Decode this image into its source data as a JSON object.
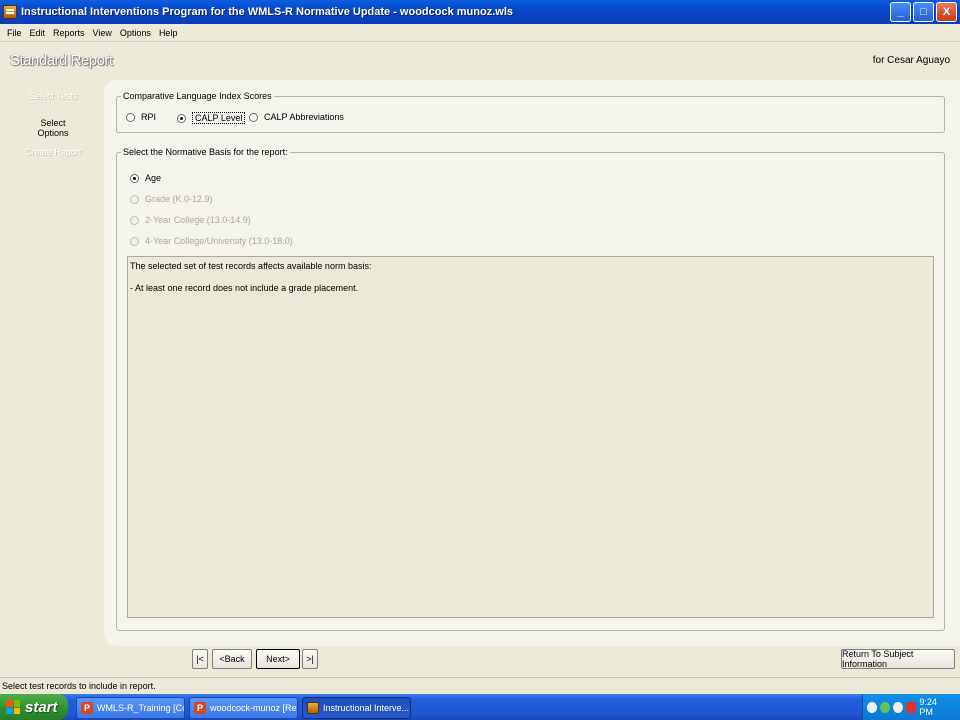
{
  "window": {
    "title": "Instructional Interventions Program for the WMLS-R Normative Update - woodcock munoz.wls",
    "buttons": {
      "minimize": "_",
      "maximize": "□",
      "close": "X"
    }
  },
  "menu": [
    "File",
    "Edit",
    "Reports",
    "View",
    "Options",
    "Help"
  ],
  "header": {
    "title": "Standard Report",
    "subject": "for Cesar Aguayo"
  },
  "nav": {
    "steps": [
      {
        "label": "Select Tests",
        "state": "disabled"
      },
      {
        "label": "Select Options",
        "state": "active"
      },
      {
        "label": "Create Report",
        "state": "disabled"
      }
    ]
  },
  "comparative_scores": {
    "legend": "Comparative Language Index Scores",
    "options": [
      {
        "label": "RPI",
        "checked": false
      },
      {
        "label": "CALP Level",
        "checked": true
      },
      {
        "label": "CALP Abbreviations",
        "checked": false
      }
    ]
  },
  "normative_basis": {
    "legend": "Select the Normative Basis for the report:",
    "options": [
      {
        "label": "Age",
        "checked": true,
        "enabled": true
      },
      {
        "label": "Grade (K.0-12.9)",
        "checked": false,
        "enabled": false
      },
      {
        "label": "2-Year College (13.0-14.9)",
        "checked": false,
        "enabled": false
      },
      {
        "label": "4-Year College/University (13.0-18.0)",
        "checked": false,
        "enabled": false
      }
    ],
    "info_lines": [
      "The selected set of test records affects available norm basis:",
      "- At least one record does not include a grade placement."
    ]
  },
  "footer_buttons": {
    "first": "|<",
    "back": "<Back",
    "next": "Next>",
    "last": ">|",
    "return": "Return To Subject Information"
  },
  "status_text": "Select test records to include in report.",
  "taskbar": {
    "start": "start",
    "tasks": [
      {
        "label": "WMLS-R_Training [Co...",
        "icon": "powerpoint-icon"
      },
      {
        "label": "woodcock-munoz [Re...",
        "icon": "powerpoint-icon"
      },
      {
        "label": "Instructional Interve...",
        "icon": "app-icon",
        "active": true
      }
    ],
    "clock": "9:24 PM"
  },
  "colors": {
    "titlebar": "#0A5FE0",
    "window_bg": "#ECE9D8",
    "panel_bg": "#F4F3EC",
    "taskbar": "#245EDB",
    "start": "#3C9B37"
  }
}
